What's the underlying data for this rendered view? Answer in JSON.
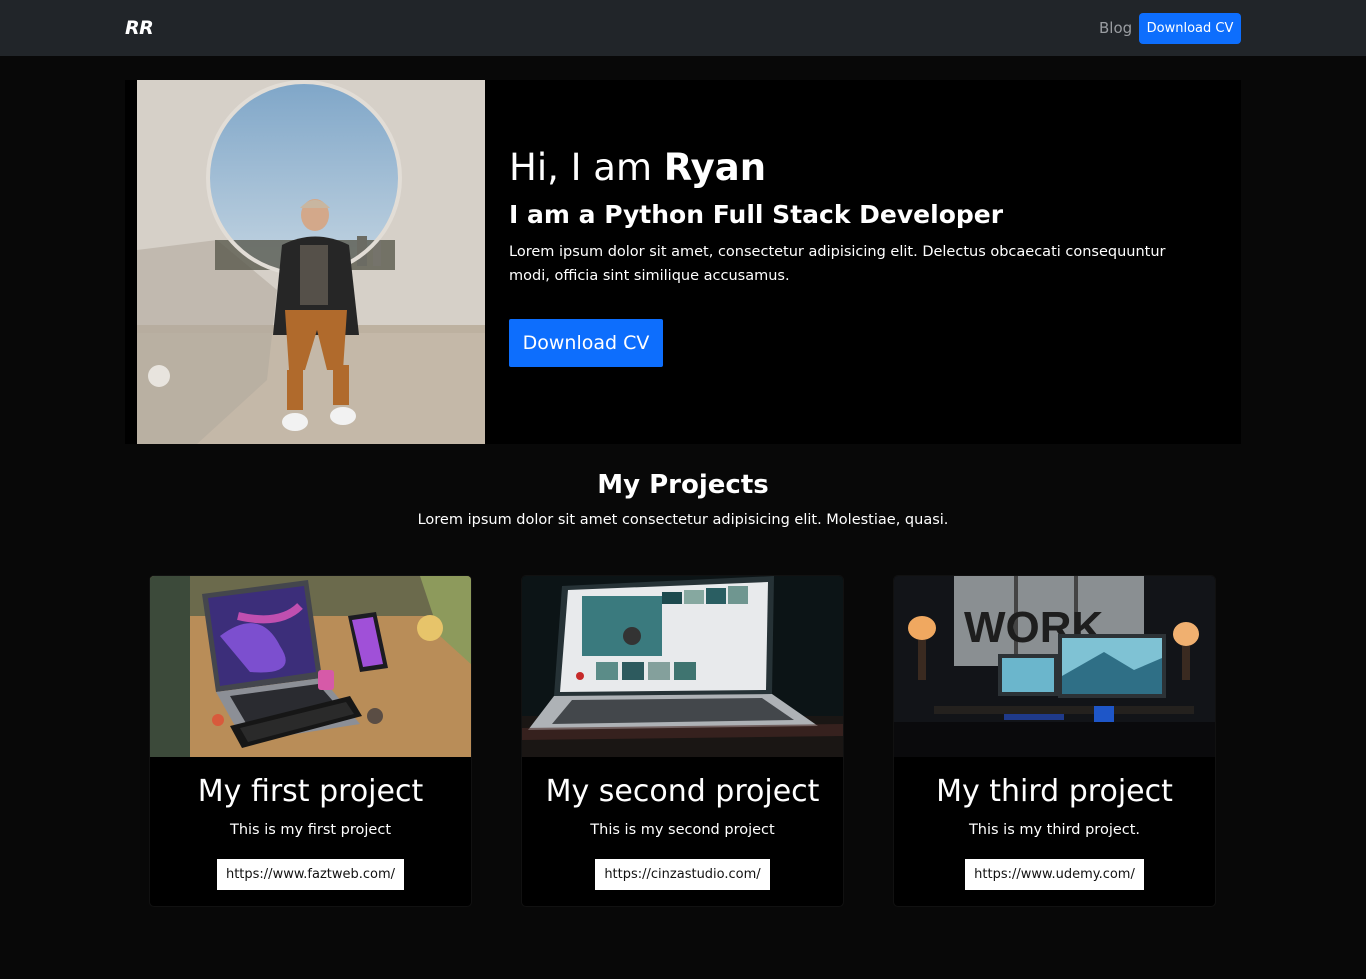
{
  "nav": {
    "brand": "RR",
    "blog_label": "Blog",
    "download_label": "Download CV"
  },
  "hero": {
    "greeting": "Hi, I am ",
    "name": "Ryan",
    "role": "I am a Python Full Stack Developer",
    "description": "Lorem ipsum dolor sit amet, consectetur adipisicing elit. Delectus obcaecati consequuntur modi, officia sint similique accusamus.",
    "button_label": "Download CV",
    "accent_color": "#0d6efd"
  },
  "projects": {
    "title": "My Projects",
    "subtitle": "Lorem ipsum dolor sit amet consectetur adipisicing elit. Molestiae, quasi.",
    "cards": [
      {
        "title": "My first project",
        "text": "This is my first project",
        "link": "https://www.faztweb.com/"
      },
      {
        "title": "My second project",
        "text": "This is my second project",
        "link": "https://cinzastudio.com/"
      },
      {
        "title": "My third project",
        "text": "This is my third project.",
        "link": "https://www.udemy.com/"
      }
    ]
  }
}
